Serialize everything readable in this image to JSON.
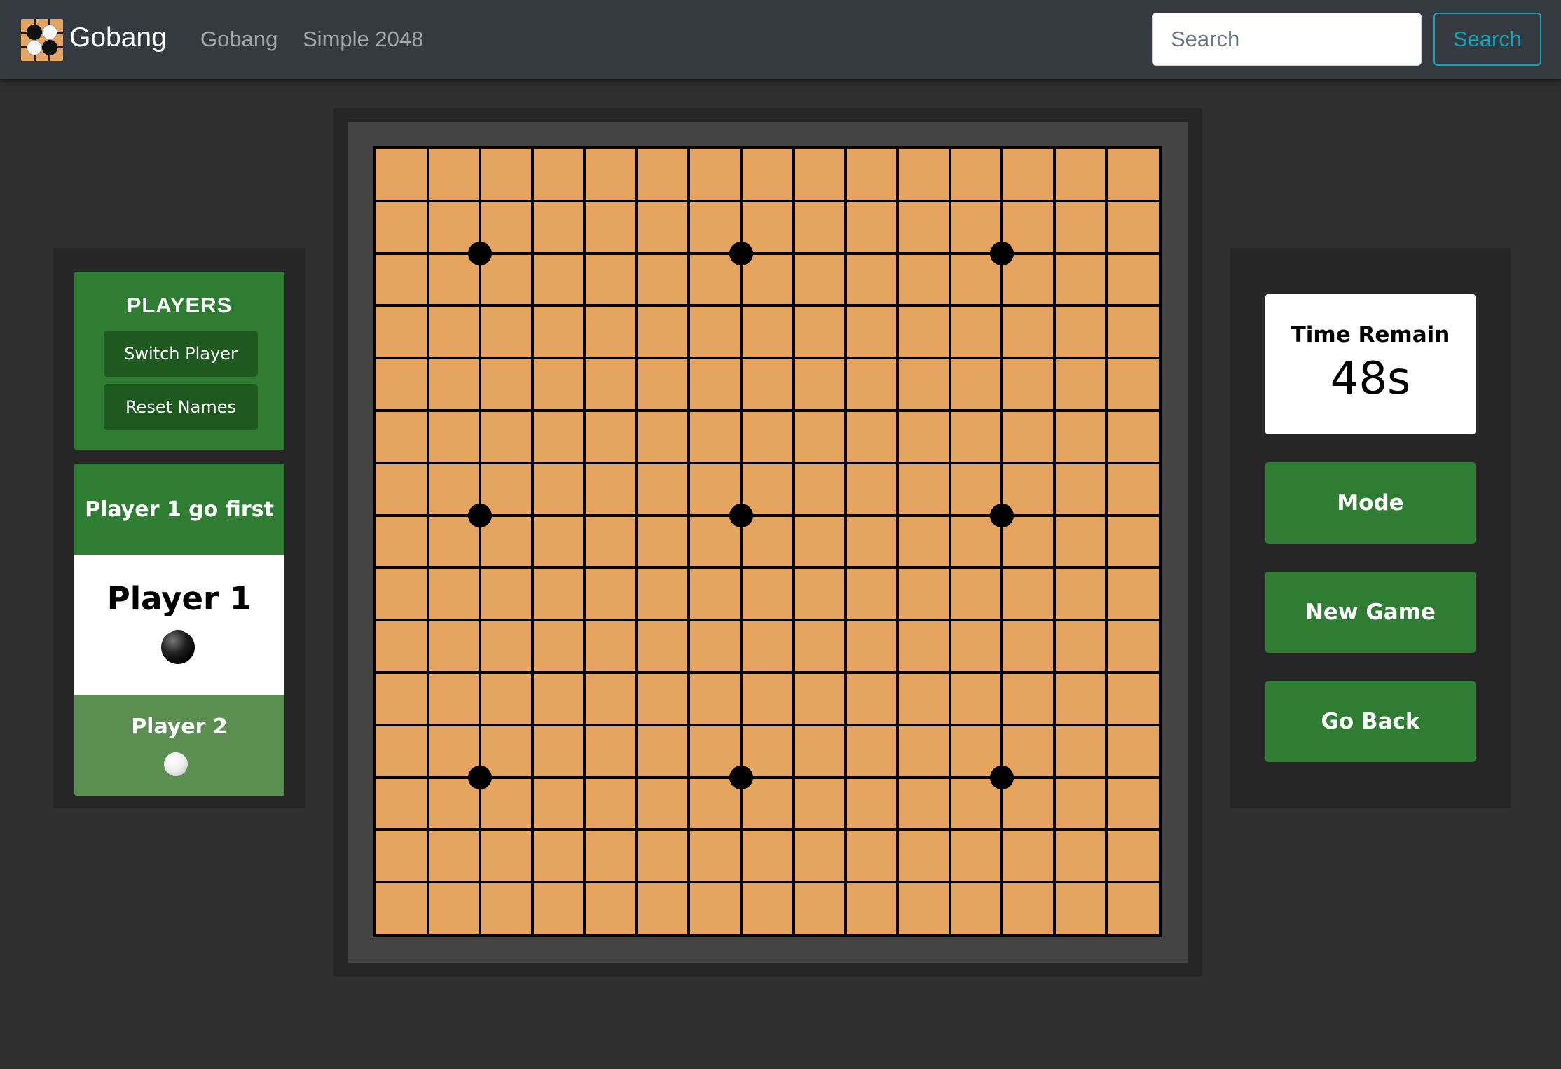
{
  "navbar": {
    "brand": "Gobang",
    "links": [
      "Gobang",
      "Simple 2048"
    ],
    "search": {
      "placeholder": "Search",
      "value": "",
      "button_label": "Search"
    }
  },
  "players_panel": {
    "title": "PLAYERS",
    "switch_label": "Switch Player",
    "reset_label": "Reset Names"
  },
  "turn": {
    "header": "Player 1 go first",
    "player1": {
      "name": "Player 1",
      "stone": "black-stone"
    },
    "player2": {
      "name": "Player 2",
      "stone": "white-stone"
    }
  },
  "board": {
    "grid_lines": 15,
    "star_points": [
      [
        2,
        2
      ],
      [
        7,
        2
      ],
      [
        12,
        2
      ],
      [
        2,
        7
      ],
      [
        7,
        7
      ],
      [
        12,
        7
      ],
      [
        2,
        12
      ],
      [
        7,
        12
      ],
      [
        12,
        12
      ]
    ],
    "colors": {
      "wood": "#e5a460",
      "line": "#000000"
    }
  },
  "right_panel": {
    "timer_label": "Time Remain",
    "timer_value": "48s",
    "buttons": [
      "Mode",
      "New Game",
      "Go Back"
    ]
  },
  "colors": {
    "accent_green": "#2e7d32",
    "dark_green": "#1e5a20",
    "inactive_green": "#5b8f52",
    "search_outline": "#17a2b8"
  }
}
